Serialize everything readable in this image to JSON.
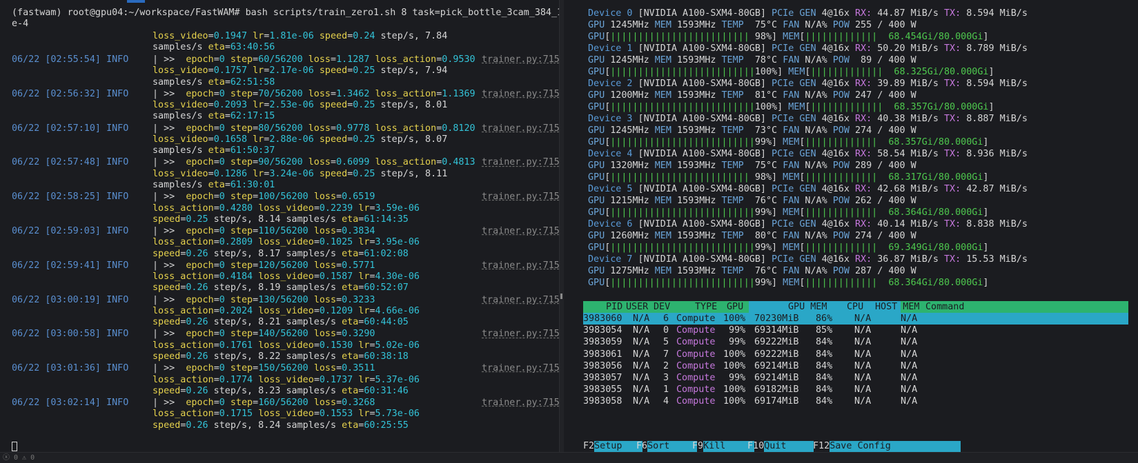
{
  "left": {
    "prompt": "(fastwam) root@gpu04:~/workspace/FastWAM# bash scripts/train_zero1.sh 8 task=pick_bottle_3cam_384_1",
    "prompt_wrap": "e-4",
    "first_cont": [
      "loss_video=0.1947 lr=1.81e-06 speed=0.24 step/s, 7.84",
      "samples/s eta=63:40:56"
    ],
    "entries": [
      {
        "ts": "06/22 [02:55:54]",
        "lvl": "INFO",
        "src": "trainer.py:715",
        "l1": "| >>  epoch=0 step=60/56200 loss=1.1287 loss_action=0.9530",
        "l2": "loss_video=0.1757 lr=2.17e-06 speed=0.25 step/s, 7.94",
        "l3": "samples/s eta=62:51:58"
      },
      {
        "ts": "06/22 [02:56:32]",
        "lvl": "INFO",
        "src": "trainer.py:715",
        "l1": "| >>  epoch=0 step=70/56200 loss=1.3462 loss_action=1.1369",
        "l2": "loss_video=0.2093 lr=2.53e-06 speed=0.25 step/s, 8.01",
        "l3": "samples/s eta=62:17:15"
      },
      {
        "ts": "06/22 [02:57:10]",
        "lvl": "INFO",
        "src": "trainer.py:715",
        "l1": "| >>  epoch=0 step=80/56200 loss=0.9778 loss_action=0.8120",
        "l2": "loss_video=0.1658 lr=2.88e-06 speed=0.25 step/s, 8.07",
        "l3": "samples/s eta=61:50:37"
      },
      {
        "ts": "06/22 [02:57:48]",
        "lvl": "INFO",
        "src": "trainer.py:715",
        "l1": "| >>  epoch=0 step=90/56200 loss=0.6099 loss_action=0.4813",
        "l2": "loss_video=0.1286 lr=3.24e-06 speed=0.25 step/s, 8.11",
        "l3": "samples/s eta=61:30:01"
      },
      {
        "ts": "06/22 [02:58:25]",
        "lvl": "INFO",
        "src": "trainer.py:715",
        "l1": "| >>  epoch=0 step=100/56200 loss=0.6519",
        "l2": "loss_action=0.4280 loss_video=0.2239 lr=3.59e-06",
        "l3": "speed=0.25 step/s, 8.14 samples/s eta=61:14:35"
      },
      {
        "ts": "06/22 [02:59:03]",
        "lvl": "INFO",
        "src": "trainer.py:715",
        "l1": "| >>  epoch=0 step=110/56200 loss=0.3834",
        "l2": "loss_action=0.2809 loss_video=0.1025 lr=3.95e-06",
        "l3": "speed=0.26 step/s, 8.17 samples/s eta=61:02:08"
      },
      {
        "ts": "06/22 [02:59:41]",
        "lvl": "INFO",
        "src": "trainer.py:715",
        "l1": "| >>  epoch=0 step=120/56200 loss=0.5771",
        "l2": "loss_action=0.4184 loss_video=0.1587 lr=4.30e-06",
        "l3": "speed=0.26 step/s, 8.19 samples/s eta=60:52:07"
      },
      {
        "ts": "06/22 [03:00:19]",
        "lvl": "INFO",
        "src": "trainer.py:715",
        "l1": "| >>  epoch=0 step=130/56200 loss=0.3233",
        "l2": "loss_action=0.2024 loss_video=0.1209 lr=4.66e-06",
        "l3": "speed=0.26 step/s, 8.21 samples/s eta=60:44:05"
      },
      {
        "ts": "06/22 [03:00:58]",
        "lvl": "INFO",
        "src": "trainer.py:715",
        "l1": "| >>  epoch=0 step=140/56200 loss=0.3290",
        "l2": "loss_action=0.1761 loss_video=0.1530 lr=5.02e-06",
        "l3": "speed=0.26 step/s, 8.22 samples/s eta=60:38:18"
      },
      {
        "ts": "06/22 [03:01:36]",
        "lvl": "INFO",
        "src": "trainer.py:715",
        "l1": "| >>  epoch=0 step=150/56200 loss=0.3511",
        "l2": "loss_action=0.1774 loss_video=0.1737 lr=5.37e-06",
        "l3": "speed=0.26 step/s, 8.23 samples/s eta=60:31:46"
      },
      {
        "ts": "06/22 [03:02:14]",
        "lvl": "INFO",
        "src": "trainer.py:715",
        "l1": "| >>  epoch=0 step=160/56200 loss=0.3268",
        "l2": "loss_action=0.1715 loss_video=0.1553 lr=5.73e-06",
        "l3": "speed=0.26 step/s, 8.24 samples/s eta=60:25:55"
      }
    ]
  },
  "devices": [
    {
      "id": "Device 0",
      "name": "[NVIDIA A100-SXM4-80GB]",
      "pcie": "4@16x",
      "rx": "44.87 MiB/s",
      "tx": "8.594 MiB/s",
      "gpu_clk": "1245MHz",
      "mem_clk": "1593MHz",
      "temp": "75°C",
      "fan": "N/A%",
      "pow": "255 / 400 W",
      "util": "98%",
      "util_frac": 0.98,
      "mem": "68.454Gi/80.000Gi",
      "mem_frac": 0.855
    },
    {
      "id": "Device 1",
      "name": "[NVIDIA A100-SXM4-80GB]",
      "pcie": "4@16x",
      "rx": "50.20 MiB/s",
      "tx": "8.789 MiB/s",
      "gpu_clk": "1245MHz",
      "mem_clk": "1593MHz",
      "temp": "78°C",
      "fan": "N/A%",
      "pow": " 89 / 400 W",
      "util": "100%",
      "util_frac": 1.0,
      "mem": "68.325Gi/80.000Gi",
      "mem_frac": 0.854
    },
    {
      "id": "Device 2",
      "name": "[NVIDIA A100-SXM4-80GB]",
      "pcie": "4@16x",
      "rx": "39.89 MiB/s",
      "tx": "8.594 MiB/s",
      "gpu_clk": "1200MHz",
      "mem_clk": "1593MHz",
      "temp": "81°C",
      "fan": "N/A%",
      "pow": "247 / 400 W",
      "util": "100%",
      "util_frac": 1.0,
      "mem": "68.357Gi/80.000Gi",
      "mem_frac": 0.854
    },
    {
      "id": "Device 3",
      "name": "[NVIDIA A100-SXM4-80GB]",
      "pcie": "4@16x",
      "rx": "40.38 MiB/s",
      "tx": "8.887 MiB/s",
      "gpu_clk": "1245MHz",
      "mem_clk": "1593MHz",
      "temp": "73°C",
      "fan": "N/A%",
      "pow": "274 / 400 W",
      "util": "99%",
      "util_frac": 0.99,
      "mem": "68.357Gi/80.000Gi",
      "mem_frac": 0.854
    },
    {
      "id": "Device 4",
      "name": "[NVIDIA A100-SXM4-80GB]",
      "pcie": "4@16x",
      "rx": "58.54 MiB/s",
      "tx": "8.936 MiB/s",
      "gpu_clk": "1320MHz",
      "mem_clk": "1593MHz",
      "temp": "75°C",
      "fan": "N/A%",
      "pow": "289 / 400 W",
      "util": "98%",
      "util_frac": 0.98,
      "mem": "68.317Gi/80.000Gi",
      "mem_frac": 0.854
    },
    {
      "id": "Device 5",
      "name": "[NVIDIA A100-SXM4-80GB]",
      "pcie": "4@16x",
      "rx": "42.68 MiB/s",
      "tx": "42.87 MiB/s",
      "gpu_clk": "1215MHz",
      "mem_clk": "1593MHz",
      "temp": "76°C",
      "fan": "N/A%",
      "pow": "262 / 400 W",
      "util": "99%",
      "util_frac": 0.99,
      "mem": "68.364Gi/80.000Gi",
      "mem_frac": 0.855
    },
    {
      "id": "Device 6",
      "name": "[NVIDIA A100-SXM4-80GB]",
      "pcie": "4@16x",
      "rx": "40.14 MiB/s",
      "tx": "8.838 MiB/s",
      "gpu_clk": "1260MHz",
      "mem_clk": "1593MHz",
      "temp": "80°C",
      "fan": "N/A%",
      "pow": "274 / 400 W",
      "util": "99%",
      "util_frac": 0.99,
      "mem": "69.349Gi/80.000Gi",
      "mem_frac": 0.867
    },
    {
      "id": "Device 7",
      "name": "[NVIDIA A100-SXM4-80GB]",
      "pcie": "4@16x",
      "rx": "36.87 MiB/s",
      "tx": "15.53 MiB/s",
      "gpu_clk": "1275MHz",
      "mem_clk": "1593MHz",
      "temp": "76°C",
      "fan": "N/A%",
      "pow": "287 / 400 W",
      "util": "99%",
      "util_frac": 0.99,
      "mem": "68.364Gi/80.000Gi",
      "mem_frac": 0.855
    }
  ],
  "labels": {
    "pcie": "PCIe",
    "gen": "GEN",
    "rx": "RX:",
    "tx": "TX:",
    "gpu": "GPU",
    "mem": "MEM",
    "temp": "TEMP",
    "fan": "FAN",
    "pow": "POW"
  },
  "proc_header": [
    "PID",
    "USER",
    "DEV",
    "TYPE",
    "GPU",
    "GPU MEM",
    "CPU",
    "HOST MEM",
    "Command"
  ],
  "procs": [
    [
      "3983060",
      "N/A",
      "6",
      "Compute",
      "100%",
      "70230MiB",
      "86%",
      "N/A",
      "N/A"
    ],
    [
      "3983054",
      "N/A",
      "0",
      "Compute",
      "99%",
      "69314MiB",
      "85%",
      "N/A",
      "N/A"
    ],
    [
      "3983059",
      "N/A",
      "5",
      "Compute",
      "99%",
      "69222MiB",
      "84%",
      "N/A",
      "N/A"
    ],
    [
      "3983061",
      "N/A",
      "7",
      "Compute",
      "100%",
      "69222MiB",
      "84%",
      "N/A",
      "N/A"
    ],
    [
      "3983056",
      "N/A",
      "2",
      "Compute",
      "100%",
      "69214MiB",
      "84%",
      "N/A",
      "N/A"
    ],
    [
      "3983057",
      "N/A",
      "3",
      "Compute",
      "99%",
      "69214MiB",
      "84%",
      "N/A",
      "N/A"
    ],
    [
      "3983055",
      "N/A",
      "1",
      "Compute",
      "100%",
      "69182MiB",
      "84%",
      "N/A",
      "N/A"
    ],
    [
      "3983058",
      "N/A",
      "4",
      "Compute",
      "100%",
      "69174MiB",
      "84%",
      "N/A",
      "N/A"
    ]
  ],
  "fkeys": [
    {
      "key": "F2",
      "label": "Setup"
    },
    {
      "key": "F6",
      "label": "Sort"
    },
    {
      "key": "F9",
      "label": "Kill"
    },
    {
      "key": "F10",
      "label": "Quit"
    },
    {
      "key": "F12",
      "label": "Save Config"
    }
  ],
  "status_bar": "ⓧ 0  ⚠ 0"
}
